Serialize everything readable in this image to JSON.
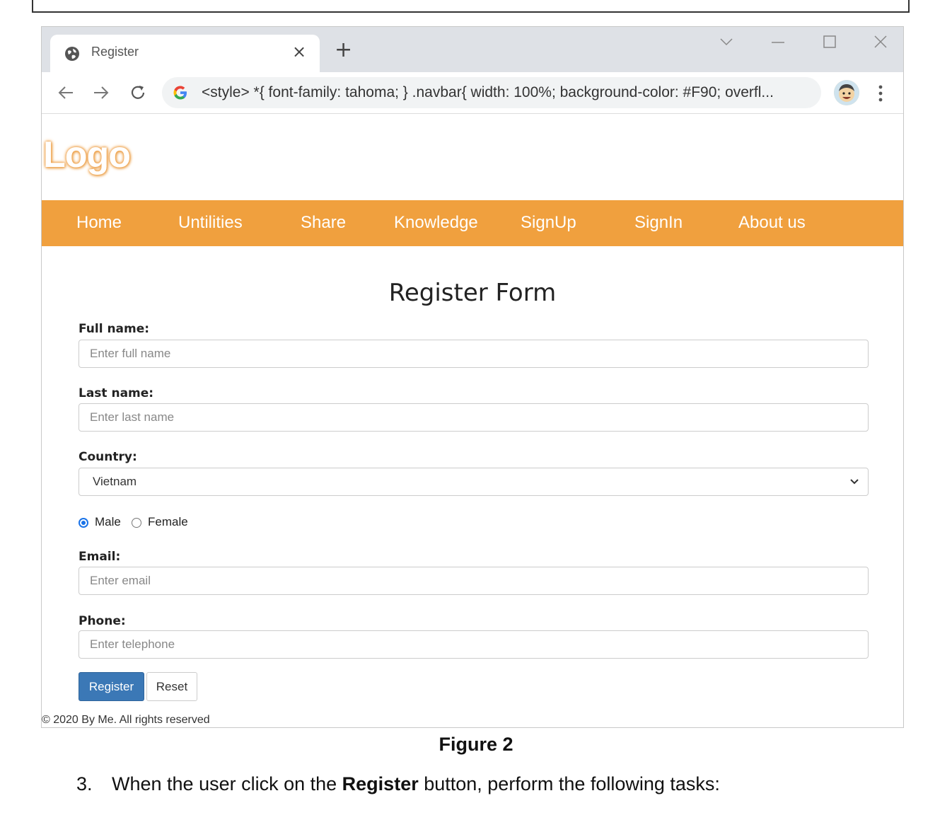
{
  "browser": {
    "tab_title": "Register",
    "tab_close": "×",
    "new_tab": "+",
    "url": "<style> *{ font-family: tahoma; } .navbar{ width: 100%; background-color: #F90; overfl..."
  },
  "page": {
    "logo": "Logo",
    "nav": [
      "Home",
      "Untilities",
      "Share",
      "Knowledge",
      "SignUp",
      "SignIn",
      "About us"
    ],
    "form_title": "Register Form",
    "full_name": {
      "label": "Full name:",
      "placeholder": "Enter full name"
    },
    "last_name": {
      "label": "Last name:",
      "placeholder": "Enter last name"
    },
    "country": {
      "label": "Country:",
      "value": "Vietnam"
    },
    "gender": {
      "male": "Male",
      "female": "Female",
      "selected": "Male"
    },
    "email": {
      "label": "Email:",
      "placeholder": "Enter email"
    },
    "phone": {
      "label": "Phone:",
      "placeholder": "Enter telephone"
    },
    "register_button": "Register",
    "reset_button": "Reset",
    "footer": "© 2020 By Me. All rights reserved"
  },
  "document": {
    "caption": "Figure 2",
    "task_number": "3.",
    "task_text_before": "When the user click on the ",
    "task_text_bold": "Register",
    "task_text_after": " button, perform the following tasks:"
  },
  "colors": {
    "navbar": "#f0a03e",
    "primary_button": "#3b78b6",
    "tabbar": "#dee1e6"
  }
}
